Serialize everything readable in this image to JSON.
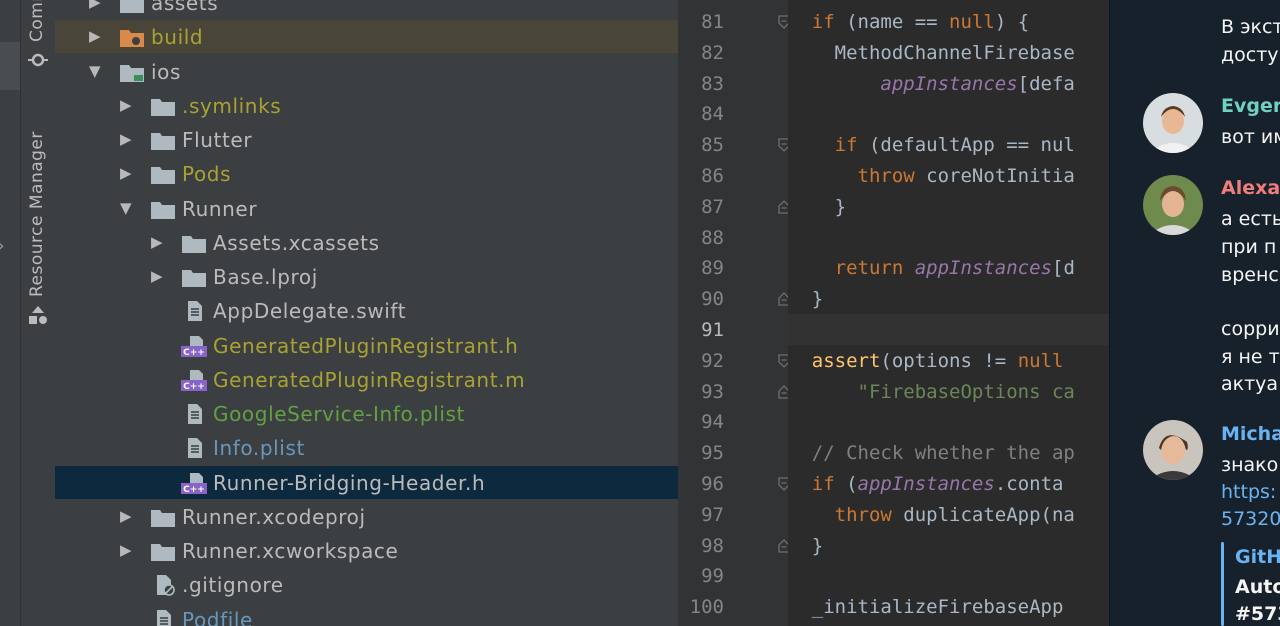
{
  "toolwindows": {
    "commit_label": "Commit",
    "resource_manager_label": "Resource Manager"
  },
  "project_tree": [
    {
      "label": "assets",
      "color": "#bbbbbb",
      "icon": "folder-icon",
      "expander": "collapsed",
      "depth": 1,
      "state": "normal"
    },
    {
      "label": "build",
      "color": "#a9a232",
      "icon": "excluded-folder-icon",
      "expander": "collapsed",
      "depth": 1,
      "state": "highlight"
    },
    {
      "label": "ios",
      "color": "#bbbbbb",
      "icon": "module-folder-icon",
      "expander": "expanded",
      "depth": 1,
      "state": "normal"
    },
    {
      "label": ".symlinks",
      "color": "#a9a232",
      "icon": "folder-icon",
      "expander": "collapsed",
      "depth": 2,
      "state": "normal"
    },
    {
      "label": "Flutter",
      "color": "#bbbbbb",
      "icon": "folder-icon",
      "expander": "collapsed",
      "depth": 2,
      "state": "normal"
    },
    {
      "label": "Pods",
      "color": "#a9a232",
      "icon": "folder-icon",
      "expander": "collapsed",
      "depth": 2,
      "state": "normal"
    },
    {
      "label": "Runner",
      "color": "#bbbbbb",
      "icon": "folder-icon",
      "expander": "expanded",
      "depth": 2,
      "state": "normal"
    },
    {
      "label": "Assets.xcassets",
      "color": "#bbbbbb",
      "icon": "folder-icon",
      "expander": "collapsed",
      "depth": 3,
      "state": "normal"
    },
    {
      "label": "Base.lproj",
      "color": "#bbbbbb",
      "icon": "folder-icon",
      "expander": "collapsed",
      "depth": 3,
      "state": "normal"
    },
    {
      "label": "AppDelegate.swift",
      "color": "#bbbbbb",
      "icon": "file-icon",
      "expander": "none",
      "depth": 3,
      "state": "normal"
    },
    {
      "label": "GeneratedPluginRegistrant.h",
      "color": "#a9a232",
      "icon": "cpp-header-icon",
      "expander": "none",
      "depth": 3,
      "state": "normal"
    },
    {
      "label": "GeneratedPluginRegistrant.m",
      "color": "#a9a232",
      "icon": "cpp-header-icon",
      "expander": "none",
      "depth": 3,
      "state": "normal"
    },
    {
      "label": "GoogleService-Info.plist",
      "color": "#62a043",
      "icon": "file-icon",
      "expander": "none",
      "depth": 3,
      "state": "normal"
    },
    {
      "label": "Info.plist",
      "color": "#6897bb",
      "icon": "file-icon",
      "expander": "none",
      "depth": 3,
      "state": "normal"
    },
    {
      "label": "Runner-Bridging-Header.h",
      "color": "#bbbbbb",
      "icon": "cpp-header-icon",
      "expander": "none",
      "depth": 3,
      "state": "selected"
    },
    {
      "label": "Runner.xcodeproj",
      "color": "#bbbbbb",
      "icon": "folder-icon",
      "expander": "collapsed",
      "depth": 2,
      "state": "normal"
    },
    {
      "label": "Runner.xcworkspace",
      "color": "#bbbbbb",
      "icon": "folder-icon",
      "expander": "collapsed",
      "depth": 2,
      "state": "normal"
    },
    {
      "label": ".gitignore",
      "color": "#bbbbbb",
      "icon": "ignored-file-icon",
      "expander": "none",
      "depth": 2,
      "state": "normal"
    },
    {
      "label": "Podfile",
      "color": "#6897bb",
      "icon": "file-icon",
      "expander": "none",
      "depth": 2,
      "state": "normal"
    }
  ],
  "editor": {
    "current_line": 91,
    "lines": [
      {
        "n": 81,
        "fold": "open",
        "tokens": [
          [
            "",
            "    "
          ],
          [
            "kw",
            "if"
          ],
          [
            "",
            " (name == "
          ],
          [
            "kw",
            "null"
          ],
          [
            "",
            ") {"
          ]
        ]
      },
      {
        "n": 82,
        "fold": "",
        "tokens": [
          [
            "",
            "      MethodChannelFirebase"
          ]
        ]
      },
      {
        "n": 83,
        "fold": "",
        "tokens": [
          [
            "",
            "          "
          ],
          [
            "it",
            "appInstances"
          ],
          [
            "",
            "[defa"
          ]
        ]
      },
      {
        "n": 84,
        "fold": "",
        "tokens": []
      },
      {
        "n": 85,
        "fold": "open",
        "tokens": [
          [
            "",
            "      "
          ],
          [
            "kw",
            "if"
          ],
          [
            "",
            " (defaultApp == nul"
          ]
        ]
      },
      {
        "n": 86,
        "fold": "",
        "tokens": [
          [
            "",
            "        "
          ],
          [
            "kw",
            "throw"
          ],
          [
            "",
            " coreNotInitia"
          ]
        ]
      },
      {
        "n": 87,
        "fold": "close",
        "tokens": [
          [
            "",
            "      }"
          ]
        ]
      },
      {
        "n": 88,
        "fold": "",
        "tokens": []
      },
      {
        "n": 89,
        "fold": "",
        "tokens": [
          [
            "",
            "      "
          ],
          [
            "kw",
            "return"
          ],
          [
            "",
            " "
          ],
          [
            "it",
            "appInstances"
          ],
          [
            "",
            "[d"
          ]
        ]
      },
      {
        "n": 90,
        "fold": "close",
        "tokens": [
          [
            "",
            "    }"
          ]
        ]
      },
      {
        "n": 91,
        "fold": "",
        "tokens": []
      },
      {
        "n": 92,
        "fold": "open",
        "tokens": [
          [
            "",
            "    "
          ],
          [
            "fn",
            "assert"
          ],
          [
            "",
            "(options != "
          ],
          [
            "kw",
            "null"
          ]
        ]
      },
      {
        "n": 93,
        "fold": "close",
        "tokens": [
          [
            "",
            "        "
          ],
          [
            "str",
            "\"FirebaseOptions ca"
          ]
        ]
      },
      {
        "n": 94,
        "fold": "",
        "tokens": []
      },
      {
        "n": 95,
        "fold": "",
        "tokens": [
          [
            "",
            "    "
          ],
          [
            "cm",
            "// Check whether the ap"
          ]
        ]
      },
      {
        "n": 96,
        "fold": "open",
        "tokens": [
          [
            "",
            "    "
          ],
          [
            "kw",
            "if"
          ],
          [
            "",
            " ("
          ],
          [
            "it",
            "appInstances"
          ],
          [
            "",
            ".conta"
          ]
        ]
      },
      {
        "n": 97,
        "fold": "",
        "tokens": [
          [
            "",
            "      "
          ],
          [
            "kw",
            "throw"
          ],
          [
            "",
            " duplicateApp(na"
          ]
        ]
      },
      {
        "n": 98,
        "fold": "close",
        "tokens": [
          [
            "",
            "    }"
          ]
        ]
      },
      {
        "n": 99,
        "fold": "",
        "tokens": []
      },
      {
        "n": 100,
        "fold": "",
        "tokens": [
          [
            "",
            "    _initializeFirebaseApp"
          ]
        ]
      }
    ]
  },
  "chat": {
    "messages": [
      {
        "id": "m0",
        "lines": [
          "В экст",
          "досту"
        ]
      },
      {
        "id": "m1",
        "author": "Evger",
        "author_color": "#6fd1c1",
        "avatar": "avatar-evger",
        "lines": [
          "вот им"
        ]
      },
      {
        "id": "m2",
        "author": "Alexa",
        "author_color": "#ee7d7d",
        "avatar": "avatar-alexa",
        "lines": [
          "а есть",
          "при п",
          "вренс",
          "",
          "сорри",
          "я не т",
          "актуа"
        ]
      },
      {
        "id": "m3",
        "author": "Micha",
        "author_color": "#6ab3f3",
        "avatar": "avatar-micha",
        "lines": [
          "знако"
        ],
        "links": [
          "https:",
          "57320"
        ],
        "preview_title": "GitH",
        "preview_lines": [
          "Auto",
          "#573"
        ]
      }
    ]
  },
  "colors": {
    "keyword": "#cc7832",
    "field": "#9876aa",
    "string": "#6a8759",
    "comment": "#808080",
    "function": "#ffc66d",
    "selection": "#0d293e",
    "chat_bg": "#17212b",
    "link": "#6ab3f3"
  }
}
